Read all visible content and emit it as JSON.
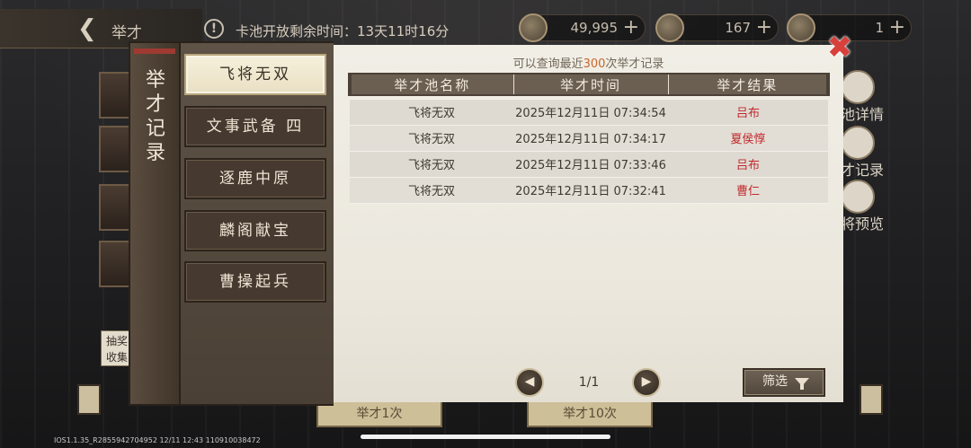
{
  "header": {
    "back_icon": "chevron-left-icon",
    "title": "举才",
    "notice_icon": "!",
    "pool_timer": "卡池开放剩余时间：13天11时16分",
    "currencies": [
      {
        "icon": "coin-icon",
        "value": "49,995",
        "plus": "+"
      },
      {
        "icon": "gear-token-icon",
        "value": "167",
        "plus": "+"
      },
      {
        "icon": "ticket-icon",
        "value": "1",
        "plus": "+"
      }
    ]
  },
  "side_buttons": [
    {
      "icon": "magnifier-icon",
      "label": "池详情"
    },
    {
      "icon": "brush-icon",
      "label": "才记录"
    },
    {
      "icon": "preview-icon",
      "label": "将预览"
    }
  ],
  "left_button": "抽奖收集",
  "bottom_tabs": [
    "举才1次",
    "举才10次"
  ],
  "dialog": {
    "ribbon_title": "举才记录",
    "tabs": [
      {
        "label": "飞将无双",
        "active": true
      },
      {
        "label": "文事武备 四",
        "active": false
      },
      {
        "label": "逐鹿中原",
        "active": false
      },
      {
        "label": "麟阁献宝",
        "active": false
      },
      {
        "label": "曹操起兵",
        "active": false
      }
    ],
    "hint_prefix": "可以查询最近",
    "hint_count": "300",
    "hint_suffix": "次举才记录",
    "table": {
      "headers": [
        "举才池名称",
        "举才时间",
        "举才结果"
      ],
      "rows": [
        {
          "pool": "飞将无双",
          "time": "2025年12月11日 07:34:54",
          "result": "吕布"
        },
        {
          "pool": "飞将无双",
          "time": "2025年12月11日 07:34:17",
          "result": "夏侯惇"
        },
        {
          "pool": "飞将无双",
          "time": "2025年12月11日 07:33:46",
          "result": "吕布"
        },
        {
          "pool": "飞将无双",
          "time": "2025年12月11日 07:32:41",
          "result": "曹仁"
        }
      ]
    },
    "pager": {
      "prev_icon": "◀",
      "page": "1/1",
      "next_icon": "▶"
    },
    "filter_label": "筛选",
    "close_icon": "✖"
  },
  "status_line": "IOS1.1.35_R2855942704952 12/11 12:43 110910038472",
  "colors": {
    "accent_orange": "#c8662c",
    "result_red": "#c1282b",
    "close_red": "#d8413b"
  }
}
